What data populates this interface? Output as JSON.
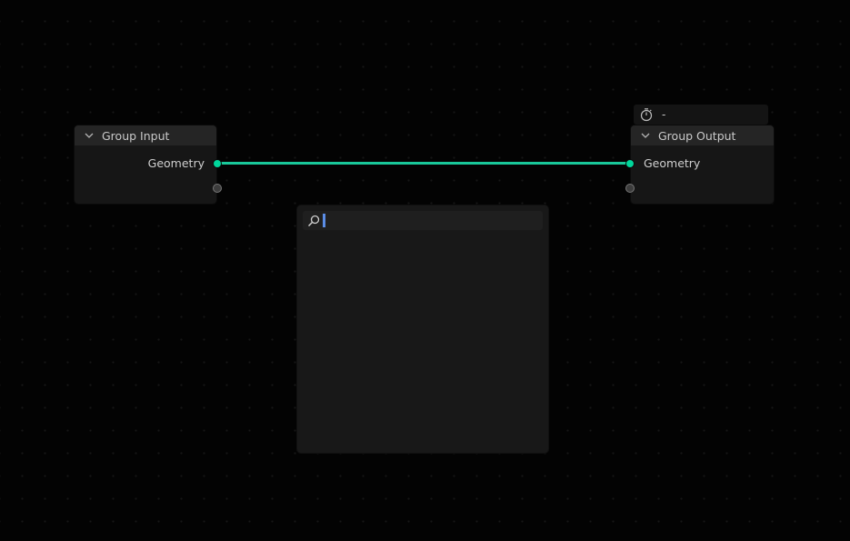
{
  "nodes": {
    "group_input": {
      "title": "Group Input",
      "output_socket": "Geometry"
    },
    "group_output": {
      "title": "Group Output",
      "input_socket": "Geometry",
      "timer_value": "-"
    }
  },
  "search": {
    "value": "",
    "placeholder": ""
  },
  "colors": {
    "geometry_socket": "#00d69b",
    "link": "#19c89a",
    "caret": "#5b8de6",
    "background": "#030303"
  },
  "icons": [
    "chevron-down-icon",
    "stopwatch-icon",
    "search-icon"
  ]
}
